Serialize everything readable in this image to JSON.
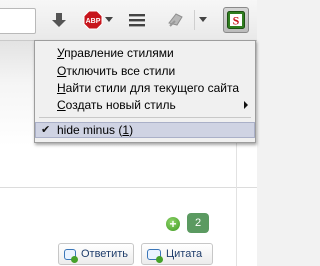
{
  "toolbar": {
    "download_icon": "download-arrow-icon",
    "adblock_label": "ABP",
    "stylish_label": "S",
    "colors": {
      "abp_red": "#c7161d",
      "stylish_green": "#2f7d1f"
    }
  },
  "menu": {
    "items": [
      {
        "pre": "",
        "u": "У",
        "post": "правление стилями"
      },
      {
        "pre": "",
        "u": "О",
        "post": "тключить все стили"
      },
      {
        "pre": "",
        "u": "Н",
        "post": "айти стили для текущего сайта"
      },
      {
        "pre": "",
        "u": "С",
        "post": "оздать новый стиль"
      }
    ],
    "style_item": {
      "name": "hide minus (",
      "key": "1",
      "close": ")"
    },
    "check_glyph": "✔"
  },
  "content": {
    "count": "2",
    "plus": "+",
    "reply_label": "Ответить",
    "quote_label": "Цитата"
  }
}
